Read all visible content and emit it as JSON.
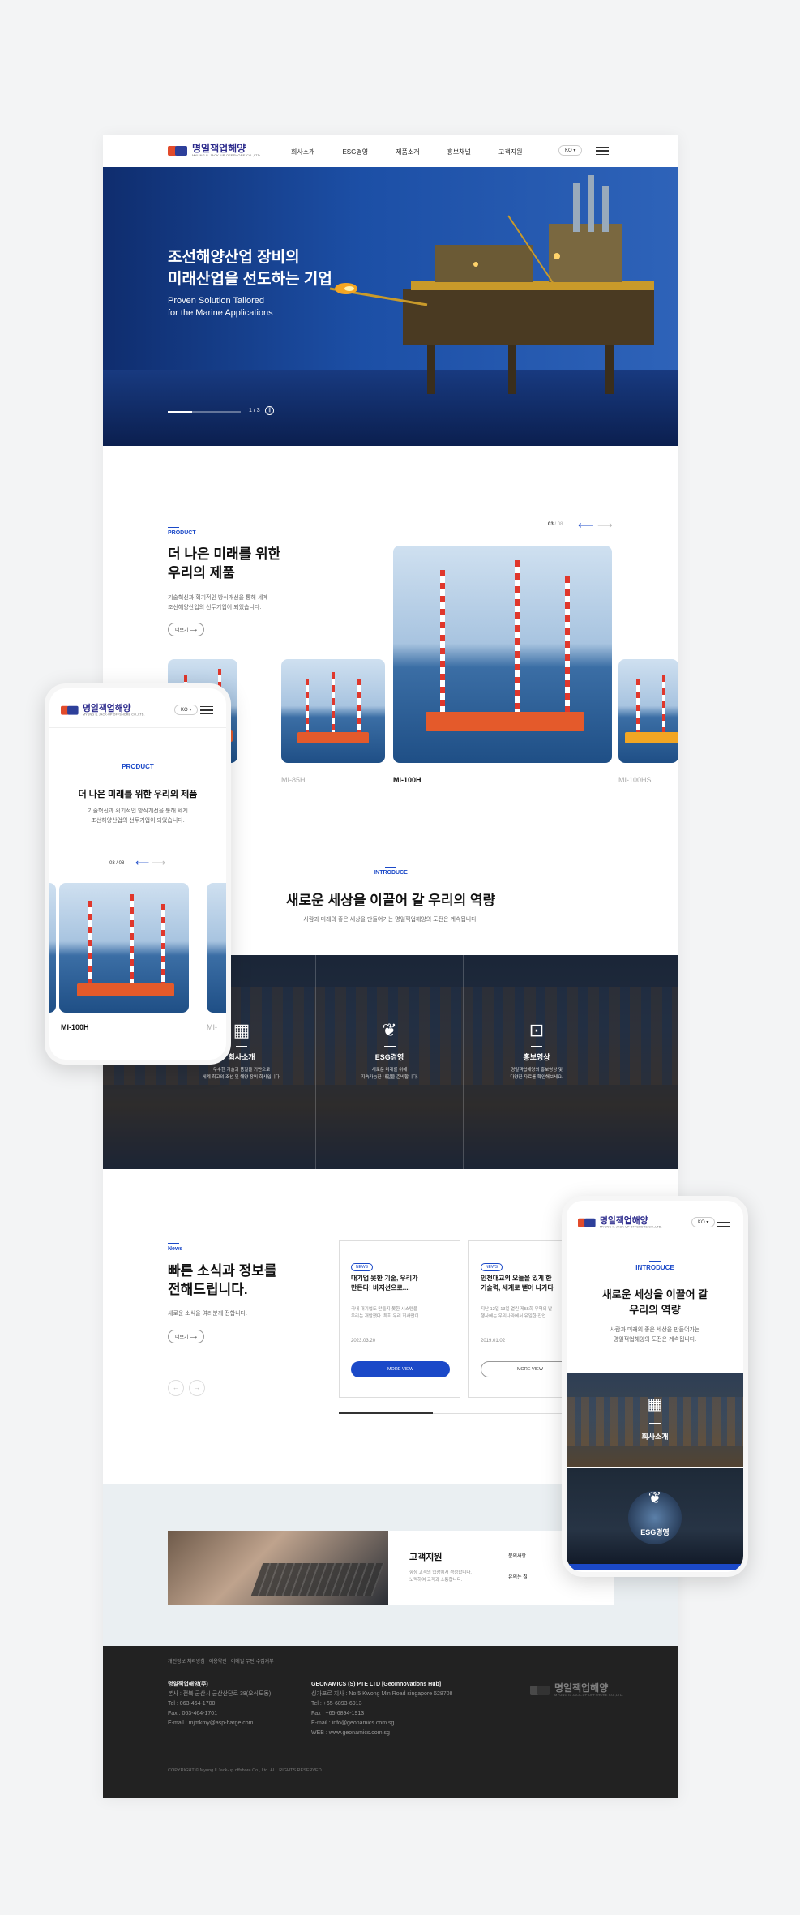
{
  "header": {
    "logo_text": "명일잭업해양",
    "logo_sub": "MYUNG IL JACK-UP OFFSHORE CO.,LTD.",
    "nav": [
      "회사소개",
      "ESG경영",
      "제품소개",
      "홍보채널",
      "고객지원"
    ],
    "lang": "KO"
  },
  "hero": {
    "title_line1": "조선해양산업 장비의",
    "title_line2": "미래산업을 선도하는 기업",
    "sub_line1": "Proven Solution Tailored",
    "sub_line2": "for the Marine Applications",
    "pager": "1 / 3",
    "progress": 0.33
  },
  "product": {
    "eyebrow": "PRODUCT",
    "title_line1": "더 나은 미래를 위한",
    "title_line2": "우리의 제품",
    "desc_line1": "기술혁신과 획기적인 방식개선을 통해 세계",
    "desc_line2": "조선해양산업의 선두기업이 되었습니다.",
    "more": "더보기",
    "pager_current": "03",
    "pager_total": "/ 08",
    "items": [
      "MI-85H",
      "MI-100H",
      "MI-100HS"
    ]
  },
  "introduce": {
    "eyebrow": "INTRODUCE",
    "title": "새로운 세상을 이끌어 갈 우리의 역량",
    "desc": "사람과 미래의 좋은 세상을 만들어가는 명일잭업해양의 도전은 계속됩니다.",
    "items": [
      {
        "title": "회사소개",
        "desc1": "우수한 기술과 품질을 기반으로",
        "desc2": "세계 최고의 조선 및 해양 장비 회사입니다."
      },
      {
        "title": "ESG경영",
        "desc1": "새로운 미래를 위해",
        "desc2": "지속가능한 내일을 준비합니다."
      },
      {
        "title": "홍보영상",
        "desc1": "명일잭업해양의 홍보영상 및",
        "desc2": "다양한 자료를 확인해보세요."
      }
    ]
  },
  "news": {
    "eyebrow": "News",
    "title_line1": "빠른 소식과 정보를",
    "title_line2": "전해드립니다.",
    "desc": "새로운 소식을 여러분께 전합니다.",
    "more": "더보기",
    "cards": [
      {
        "tag": "NEWS",
        "title1": "대기업 못한 기술, 우리가",
        "title2": "만든다! 바지선으로....",
        "body1": "국내 대기업도 만들지 못한 시스템을",
        "body2": "우리는 개발했다. 특히 우리 회사만이...",
        "date": "2023.03.20",
        "button": "MORE VIEW"
      },
      {
        "tag": "NEWS",
        "title1": "인천대교의 오늘을 있게 한",
        "title2": "기술력, 세계로 뻗어 나가다",
        "body1": "지난 12일 13일 열린 제55회 무역의 날",
        "body2": "행사에는 우리나라에서 유일한 잡업...",
        "date": "2019.01.02",
        "button": "MORE VIEW"
      }
    ]
  },
  "support": {
    "title": "고객지원",
    "desc1": "항상 고객의 입장에서 경청합니다.",
    "desc2": "노력하여 고객과 소통합니다.",
    "field1": "문의사항",
    "field2": "유의는 질"
  },
  "footer": {
    "links": "개인정보 처리방침  |  이용약관  |  이메일 무단 수집거부",
    "company1": "명일잭업해양(주)",
    "addr1": "본사 : 전북 군산시 군산산단로 38(오식도동)",
    "tel1": "Tel : 063-464-1700",
    "fax1": "Fax : 063-464-1701",
    "mail1": "E-mail : mjmkmy@asp-barge.com",
    "company2": "GEONAMICS (S) PTE LTD [GeoInnovations Hub]",
    "addr2": "싱가포르 지사 : No.5 Kwong Min Road singapore 628708",
    "tel2": "Tel : +65-6893-6913",
    "fax2": "Fax : +65-6894-1913",
    "mail2": "E-mail : info@geonamics.com.sg",
    "web2": "WEB : www.geonamics.com.sg",
    "copyright": "COPYRIGHT © Myung Il Jack-up offshore Co., Ltd. ALL RIGHTS RESERVED"
  },
  "mobile1": {
    "eyebrow": "PRODUCT",
    "title": "더 나은 미래를 위한 우리의 제품",
    "desc1": "기술혁신과 획기적인 방식개선을 통해 세계",
    "desc2": "조선해양산업의 선두기업이 되었습니다.",
    "pager": "03 / 08",
    "item": "MI-100H",
    "item_next": "MI-"
  },
  "mobile2": {
    "eyebrow": "INTRODUCE",
    "title_line1": "새로운 세상을 이끌어 갈",
    "title_line2": "우리의 역량",
    "desc1": "사람과 미래의 좋은 세상을 만들어가는",
    "desc2": "명일잭업해양의 도전은 계속됩니다.",
    "item1": "회사소개",
    "item2": "ESG경영"
  }
}
